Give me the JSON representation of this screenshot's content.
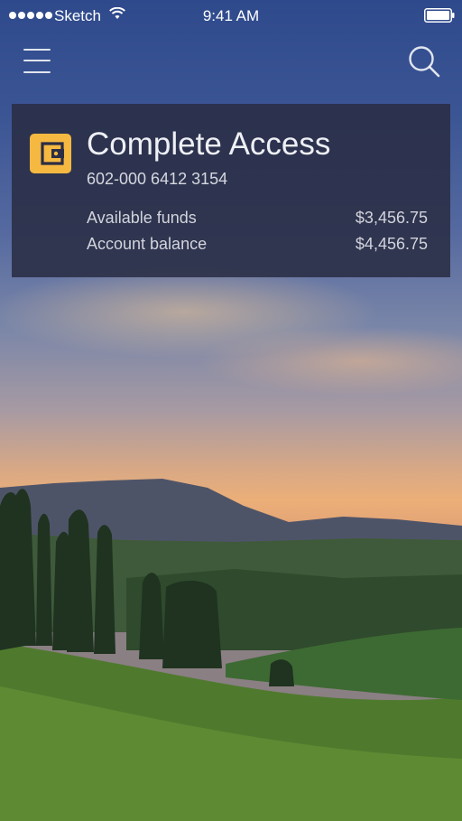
{
  "status_bar": {
    "carrier": "Sketch",
    "time": "9:41 AM",
    "signal_bars": 5,
    "battery_level": 1.0
  },
  "nav": {
    "menu_icon": "hamburger-menu-icon",
    "search_icon": "search-icon"
  },
  "account": {
    "name": "Complete Access",
    "number": "602-000 6412 3154",
    "icon": "wallet-icon",
    "accent_color": "#f5b942",
    "available_label": "Available funds",
    "available_value": "$3,456.75",
    "balance_label": "Account balance",
    "balance_value": "$4,456.75"
  }
}
